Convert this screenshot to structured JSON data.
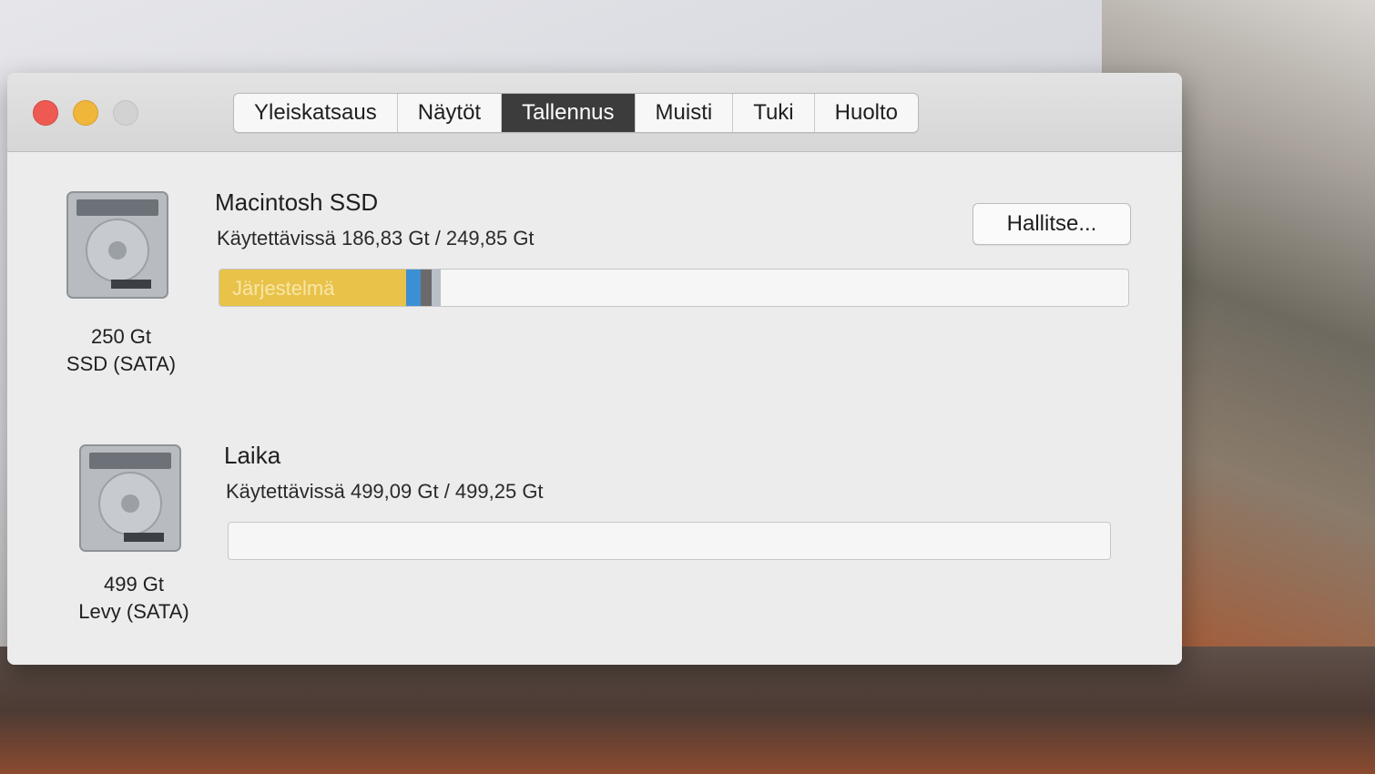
{
  "window": {
    "tabs": [
      {
        "label": "Yleiskatsaus",
        "active": false
      },
      {
        "label": "Näytöt",
        "active": false
      },
      {
        "label": "Tallennus",
        "active": true
      },
      {
        "label": "Muisti",
        "active": false
      },
      {
        "label": "Tuki",
        "active": false
      },
      {
        "label": "Huolto",
        "active": false
      }
    ]
  },
  "disks": [
    {
      "capacity_label": "250 Gt",
      "type_label": "SSD (SATA)",
      "volume_name": "Macintosh SSD",
      "availability": "Käytettävissä 186,83 Gt / 249,85 Gt",
      "segments": [
        {
          "name": "Järjestelmä",
          "fraction": 0.205,
          "color": "#e9c24a"
        },
        {
          "name": "",
          "fraction": 0.016,
          "color": "#3b8fd3"
        },
        {
          "name": "",
          "fraction": 0.012,
          "color": "#6a6a6a"
        },
        {
          "name": "",
          "fraction": 0.01,
          "color": "#b9bfc6"
        }
      ]
    },
    {
      "capacity_label": "499 Gt",
      "type_label": "Levy (SATA)",
      "volume_name": "Laika",
      "availability": "Käytettävissä 499,09 Gt / 499,25 Gt",
      "segments": []
    }
  ],
  "manage_button": {
    "label": "Hallitse..."
  },
  "icons": {
    "close": "close-button",
    "minimize": "minimize-button",
    "zoom": "zoom-button",
    "disk": "hard-drive-icon"
  }
}
